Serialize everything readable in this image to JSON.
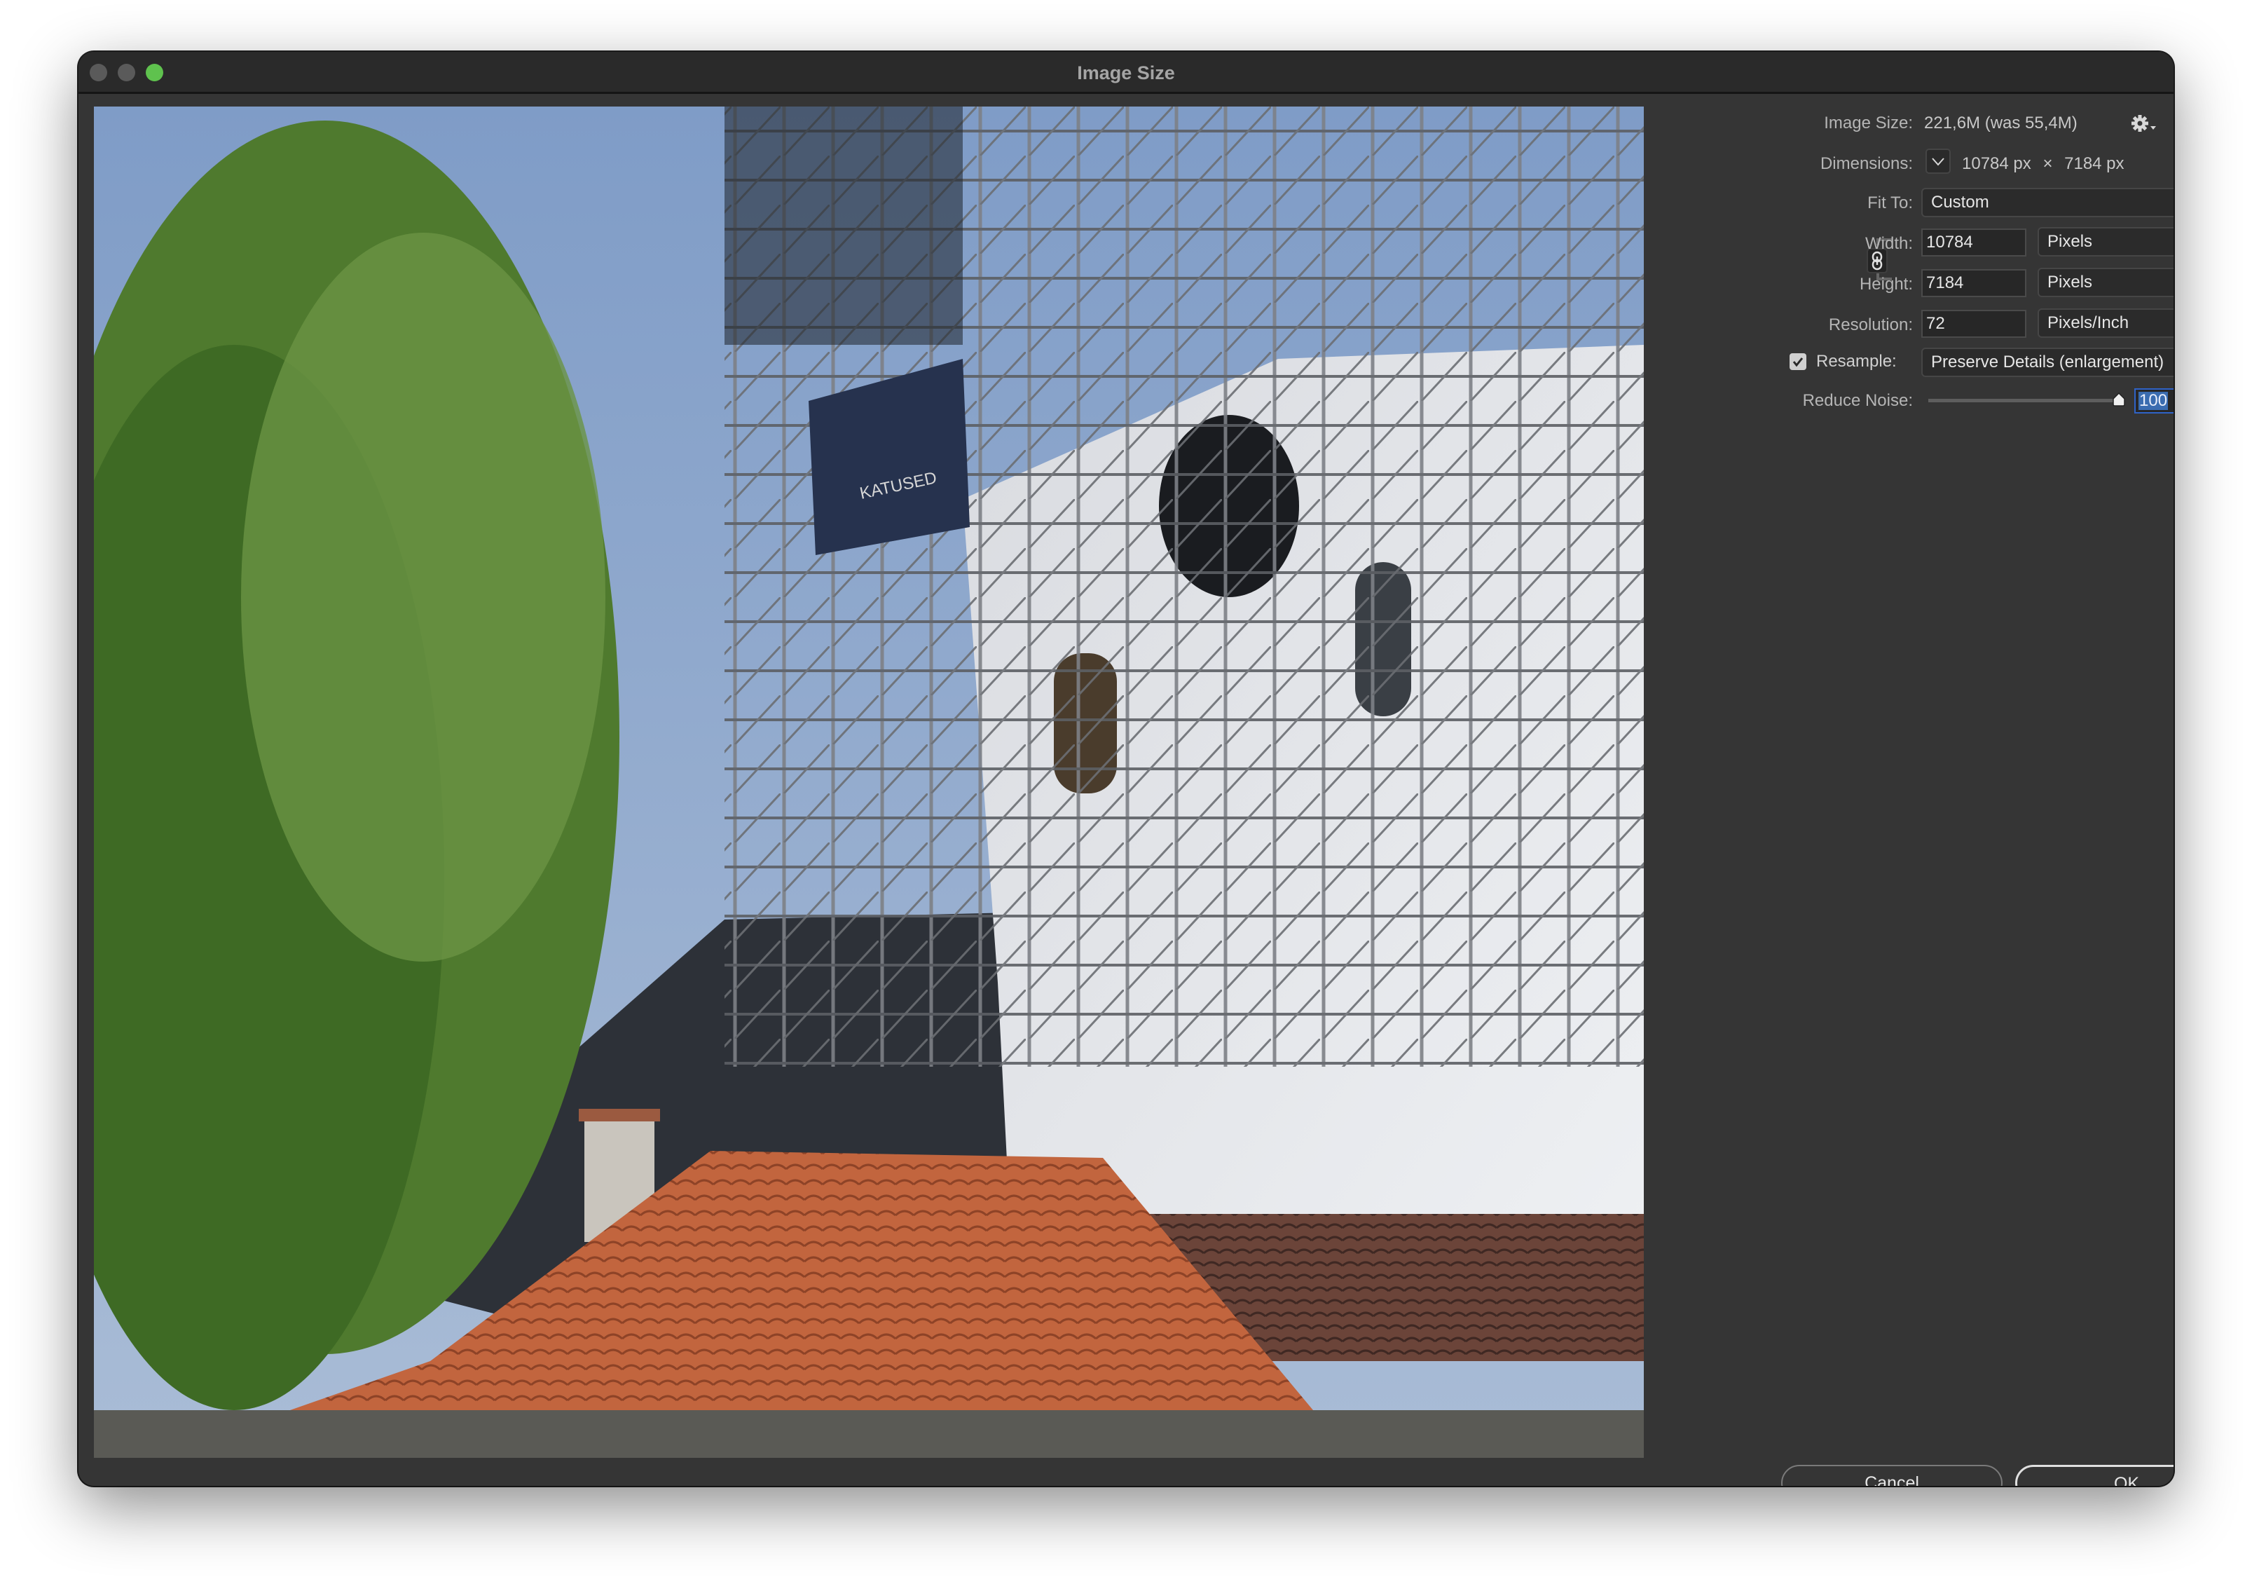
{
  "window": {
    "title": "Image Size",
    "traffic_lights": [
      "close",
      "minimize",
      "zoom"
    ]
  },
  "preview": {
    "description": "Photo preview: birch tree, church tower with scaffolding and clock, orange tiled roof",
    "banner_text": "KATUSED"
  },
  "panel": {
    "image_size": {
      "label": "Image Size:",
      "value": "221,6M (was 55,4M)"
    },
    "settings_icon": "gear-icon",
    "dimensions": {
      "label": "Dimensions:",
      "width_value": "10784 px",
      "times": "×",
      "height_value": "7184 px"
    },
    "fit_to": {
      "label": "Fit To:",
      "selected": "Custom"
    },
    "width": {
      "label": "Width:",
      "value": "10784",
      "unit": "Pixels"
    },
    "height": {
      "label": "Height:",
      "value": "7184",
      "unit": "Pixels"
    },
    "resolution": {
      "label": "Resolution:",
      "value": "72",
      "unit": "Pixels/Inch"
    },
    "constrain_proportions": {
      "linked": true
    },
    "resample": {
      "label": "Resample:",
      "checked": true,
      "selected": "Preserve Details (enlargement)"
    },
    "reduce_noise": {
      "label": "Reduce Noise:",
      "value": "100",
      "unit": "%",
      "slider_fraction": 1.0
    }
  },
  "buttons": {
    "cancel": "Cancel",
    "ok": "OK"
  },
  "colors": {
    "window_bg": "#353535",
    "titlebar_bg": "#2a2a2a",
    "zoom_light": "#5fc24e",
    "focus_ring": "#2f63c7",
    "selection": "#3a6cb0"
  }
}
